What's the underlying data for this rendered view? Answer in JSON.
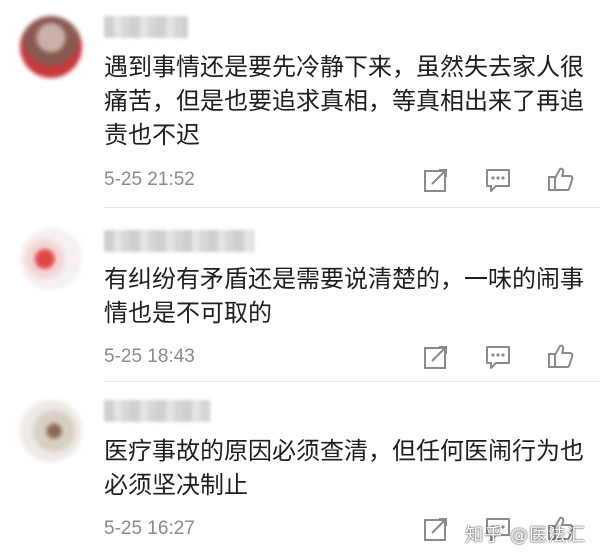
{
  "comments": [
    {
      "text": "遇到事情还是要先冷静下来，虽然失去家人很痛苦，但是也要追求真相，等真相出来了再追责也不迟",
      "time": "5-25 21:52"
    },
    {
      "text": "有纠纷有矛盾还是需要说清楚的，一味的闹事情也是不可取的",
      "time": "5-25 18:43"
    },
    {
      "text": "医疗事故的原因必须查清，但任何医闹行为也必须坚决制止",
      "time": "5-25 16:27"
    }
  ],
  "icons": {
    "forward": "share-forward-icon",
    "comment": "comment-icon",
    "like": "thumbs-up-icon"
  },
  "watermark": "知乎 @医法汇",
  "colors": {
    "icon": "#8a8a8a",
    "text": "#1e1e1e",
    "meta": "#8a8a8a"
  }
}
